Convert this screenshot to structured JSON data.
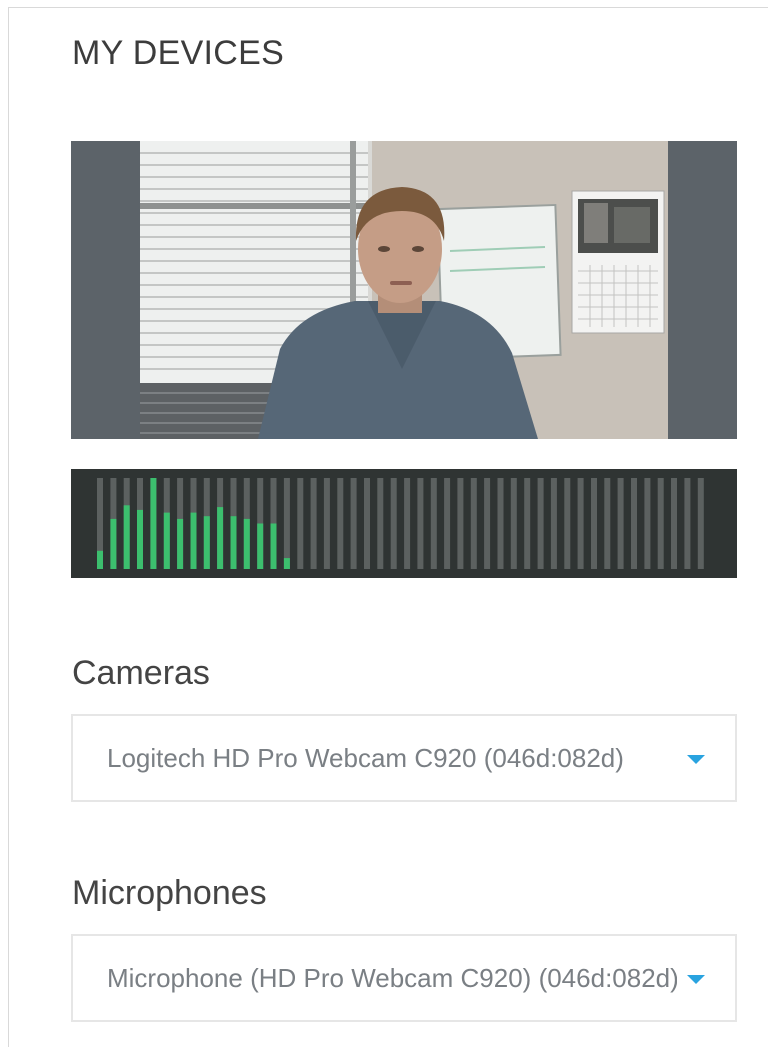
{
  "devices": {
    "title": "MY DEVICES"
  },
  "video_preview": {
    "background_color": "#5c6369",
    "content": "camera-feed"
  },
  "audio_meter": {
    "bar_count": 46,
    "active_color": "#3cbf6e",
    "inactive_color": "#5c6160",
    "background_color": "#2f3433",
    "levels": [
      0.2,
      0.55,
      0.7,
      0.65,
      1.0,
      0.62,
      0.55,
      0.62,
      0.58,
      0.68,
      0.58,
      0.55,
      0.5,
      0.5,
      0.12
    ]
  },
  "cameras": {
    "label": "Cameras",
    "selected": "Logitech HD Pro Webcam C920 (046d:082d)",
    "caret_color": "#29a3e0"
  },
  "microphones": {
    "label": "Microphones",
    "selected": "Microphone (HD Pro Webcam C920) (046d:082d)",
    "caret_color": "#29a3e0"
  }
}
